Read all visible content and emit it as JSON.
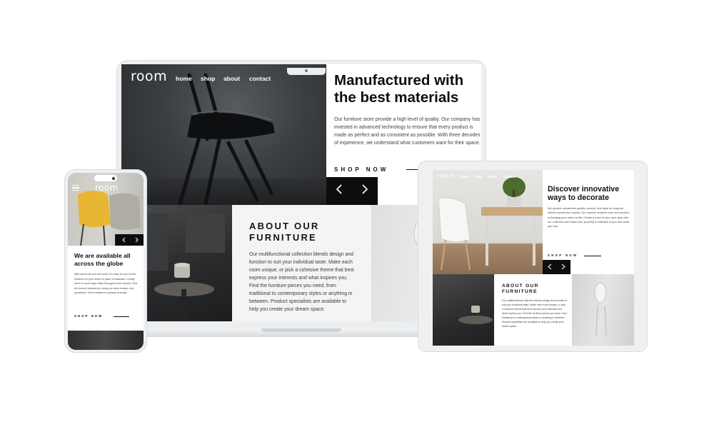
{
  "site": {
    "logo": "room",
    "nav": [
      "home",
      "shop",
      "about",
      "contact"
    ]
  },
  "hero": {
    "title": "Manufactured with the best materials",
    "body": "Our furniture store provide a high level of quality. Our company has invested in advanced technology to ensure that every product is made as perfect and as consistent as possible. With three decodes of experience, we understand what customers want for their space.",
    "cta": "SHOP NOW",
    "prev_icon": "chevron-left-icon",
    "next_icon": "chevron-right-icon"
  },
  "about": {
    "title_line1": "ABOUT OUR",
    "title_line2": "FURNITURE",
    "body": "Our multifunctional collection blends design and function to suit your individual taste. Make each room unique, or pick a cohesive theme that best express your interests and what inspires you. Find the furniture pieces you need, from traditional to contemporary styles or anything in between. Product specialists are available to help you create your dream space."
  },
  "phone": {
    "logo": "room",
    "title": "We are available all across the globe",
    "body": "With stores all over the world, it's easy for you to find furniture for your home or place of business. Locally, we're in most major cities throughout the country. Find the branch nearest you using our store locator. Any questions? Don't hesitate to contact us today.",
    "cta": "SHOP NOW"
  },
  "tablet": {
    "logo": "room",
    "nav": [
      "home",
      "shop",
      "about",
      "contact"
    ],
    "title": "Discover innovative ways to decorate",
    "body": "We provide unmatched quality, comfort, and style for property owners across the country. Our experts combine form and function in bringing your vision to life. Create a room in your own style with our collection and make your property a reflection of you and what you love.",
    "cta": "SHOP NOW",
    "about_title_line1": "ABOUT OUR",
    "about_title_line2": "FURNITURE",
    "about_body": "Our multifunctional collection blends design and function to suit your individual taste. Make each room unique, or pick a cohesive theme that best express your interests and what inspires you. Find the furniture pieces you need, from traditional to contemporary styles or anything in between. Product specialists are available to help you create your dream space."
  }
}
